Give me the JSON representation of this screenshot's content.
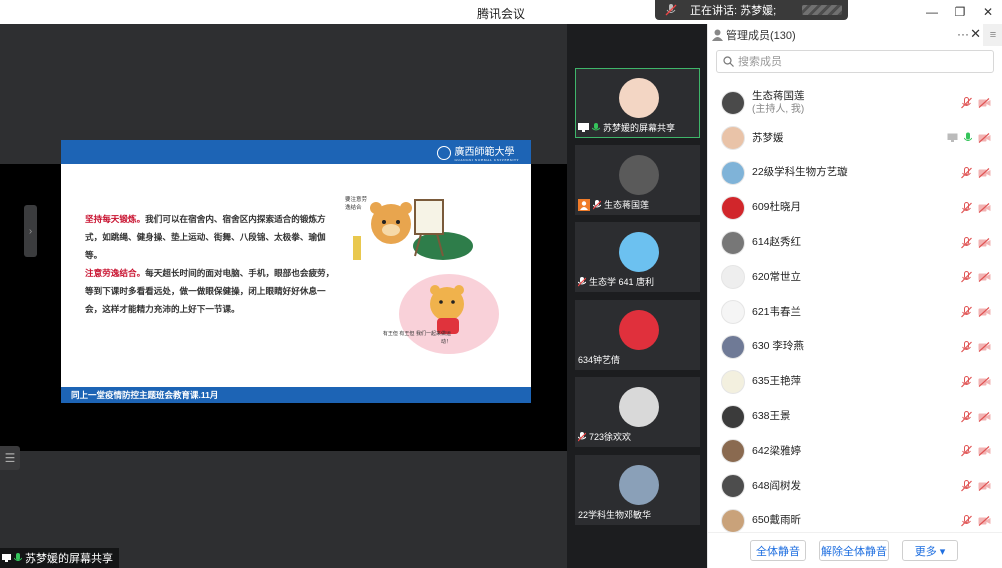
{
  "window": {
    "title": "腾讯会议",
    "speaking_label": "正在讲话: 苏梦媛;",
    "controls": [
      "—",
      "❐",
      "✕"
    ]
  },
  "share": {
    "footer_label": "苏梦媛的屏幕共享",
    "slide": {
      "logo_text": "廣西師範大學",
      "logo_en": "GUANGXI NORMAL UNIVERSITY",
      "para1_title": "坚持每天锻炼。",
      "para1_text": "我们可以在宿舍内、宿舍区内探索适合的锻炼方式，如跳绳、健身操、垫上运动、街舞、八段锦、太极拳、瑜伽等。",
      "para2_title": "注意劳逸结合。",
      "para2_text": "每天超长时间的面对电脑、手机，眼部也会疲劳，等到下课时多看看远处，做一做眼保健操，闭上眼睛好好休息一会，这样才能精力充沛的上好下一节课。",
      "illus1_text": "要注意劳逸结合",
      "illus2_text": "有王但 有王但 我们一起来做运动！",
      "footer": "同上一堂疫情防控主题班会教育课.11月"
    }
  },
  "video_tiles": [
    {
      "label": "苏梦媛的屏幕共享",
      "active": true,
      "avatar_color": "#f3d6c4"
    },
    {
      "label": "生态蒋国莲",
      "active": false,
      "avatar_color": "#5a5a5a"
    },
    {
      "label": "生态学  641 唐利",
      "active": false,
      "avatar_color": "#6cc1f0"
    },
    {
      "label": "634钟艺倩",
      "active": false,
      "avatar_color": "#e0303c"
    },
    {
      "label": "723徐欢欢",
      "active": false,
      "avatar_color": "#d9d9d9"
    },
    {
      "label": "22学科生物邓敏华",
      "active": false,
      "avatar_color": "#8aa0b8"
    }
  ],
  "panel": {
    "title": "管理成员(130)",
    "search_placeholder": "搜索成员",
    "members": [
      {
        "name": "生态蒋国莲",
        "sub": "(主持人, 我)",
        "color": "#4a4a4a",
        "state": "muted"
      },
      {
        "name": "苏梦媛",
        "sub": "",
        "color": "#e9c3a8",
        "state": "speaking"
      },
      {
        "name": "22级学科生物方艺璇",
        "sub": "",
        "color": "#7fb3d8",
        "state": "muted"
      },
      {
        "name": "609杜晓月",
        "sub": "",
        "color": "#d1262b",
        "state": "muted"
      },
      {
        "name": "614赵秀红",
        "sub": "",
        "color": "#777777",
        "state": "muted"
      },
      {
        "name": "620常世立",
        "sub": "",
        "color": "#eeeeee",
        "state": "muted"
      },
      {
        "name": "621韦春兰",
        "sub": "",
        "color": "#f5f5f5",
        "state": "muted"
      },
      {
        "name": "630 李玲燕",
        "sub": "",
        "color": "#6f7a96",
        "state": "muted"
      },
      {
        "name": "635王艳萍",
        "sub": "",
        "color": "#f3f0df",
        "state": "muted"
      },
      {
        "name": "638王景",
        "sub": "",
        "color": "#3b3b3b",
        "state": "muted"
      },
      {
        "name": "642梁雅婷",
        "sub": "",
        "color": "#8a6a50",
        "state": "muted"
      },
      {
        "name": "648阎树发",
        "sub": "",
        "color": "#4d4d4d",
        "state": "muted"
      },
      {
        "name": "650戴雨昕",
        "sub": "",
        "color": "#c9a27a",
        "state": "muted"
      }
    ],
    "buttons": {
      "mute_all": "全体静音",
      "unmute_all": "解除全体静音",
      "more": "更多 ▾"
    }
  },
  "colors": {
    "accent": "#1f6fe0",
    "slide_blue": "#1d64b5",
    "slide_red": "#c8102e",
    "active_border": "#3fb56a"
  }
}
